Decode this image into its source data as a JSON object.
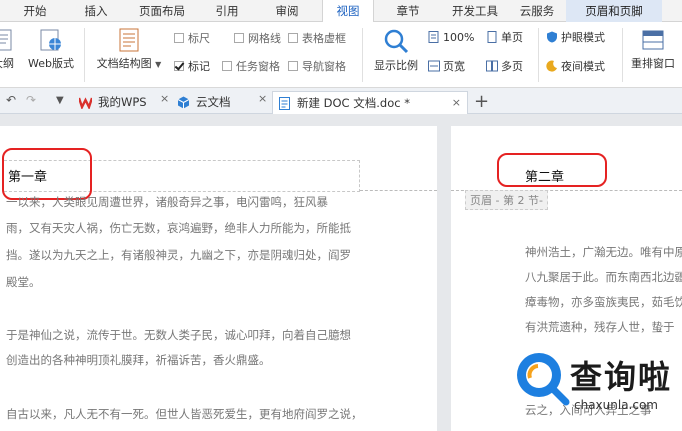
{
  "ribbon_tabs": [
    "开始",
    "插入",
    "页面布局",
    "引用",
    "审阅",
    "视图",
    "章节",
    "开发工具",
    "云服务",
    "页眉和页脚"
  ],
  "active_tab": "视图",
  "ribbon": {
    "outline_partial": "大纲",
    "web_layout": "Web版式",
    "doc_structure": "文档结构图",
    "ruler": "标尺",
    "gridlines": "网格线",
    "table_gridlines": "表格虚框",
    "markup": "标记",
    "task_pane": "任务窗格",
    "nav_pane": "导航窗格",
    "zoom": "显示比例",
    "zoom_100": "100%",
    "single_page": "单页",
    "page_width": "页宽",
    "multi_page": "多页",
    "eye_mode": "护眼模式",
    "night_mode": "夜间模式",
    "rearrange": "重排窗口"
  },
  "doc_tabs": {
    "wps": "我的WPS",
    "cloud": "云文档",
    "active_doc": "新建 DOC 文档.doc *"
  },
  "left_page": {
    "heading": "第一章",
    "line1": "一以来，人类眼见周遭世界，诸般奇异之事，电闪雷鸣，狂风暴",
    "line2": "雨，又有天灾人祸，伤亡无数，哀鸿遍野，绝非人力所能为，所能抵",
    "line3": "挡。遂以为九天之上，有诸般神灵，九幽之下，亦是阴魂归处，阎罗",
    "line4": "殿堂。",
    "line5": "于是神仙之说，流传于世。无数人类子民，诚心叩拜，向着自己臆想",
    "line6": "创造出的各种神明顶礼膜拜，祈福诉苦，香火鼎盛。",
    "line7": "自古以来，凡人无不有一死。但世人皆恶死爱生，更有地府阎罗之说，"
  },
  "right_page": {
    "heading": "第二章",
    "header_label": "页眉 - 第 2 节-",
    "line1": "神州浩土，广瀚无边。唯有中原",
    "line2": "八九聚居于此。而东南西北边疆",
    "line3": "瘴毒物，亦多蛮族夷民，茹毛饮",
    "line4": "有洪荒遗种，残存人世，蛰于",
    "line5": "云之，入间可入异土之事"
  },
  "watermark": {
    "brand": "查询啦",
    "domain": "chaxunla.com"
  },
  "colors": {
    "accent": "#1a60c0",
    "annotation_red": "#e52222"
  }
}
